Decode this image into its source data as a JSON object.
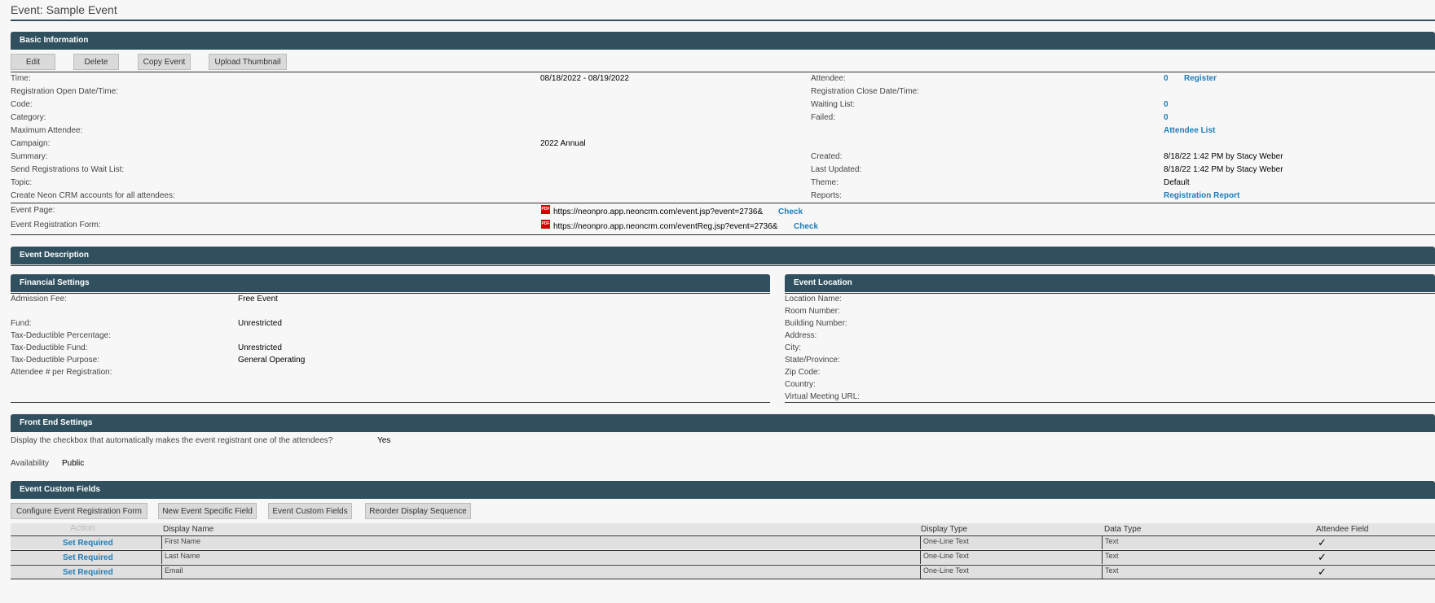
{
  "page": {
    "title": "Event: Sample Event"
  },
  "basic": {
    "header": "Basic Information",
    "buttons": {
      "edit": "Edit",
      "delete": "Delete",
      "copy": "Copy Event",
      "upload": "Upload Thumbnail"
    },
    "labels": {
      "time": "Time:",
      "reg_open": "Registration Open Date/Time:",
      "code": "Code:",
      "category": "Category:",
      "max_attendee": "Maximum Attendee:",
      "campaign": "Campaign:",
      "summary": "Summary:",
      "send_wait": "Send Registrations to Wait List:",
      "topic": "Topic:",
      "create_accounts": "Create Neon CRM accounts for all attendees:",
      "attendee": "Attendee:",
      "reg_close": "Registration Close Date/Time:",
      "waiting": "Waiting List:",
      "failed": "Failed:",
      "created": "Created:",
      "last_updated": "Last Updated:",
      "theme": "Theme:",
      "reports": "Reports:",
      "event_page": "Event Page:",
      "event_reg_form": "Event Registration Form:"
    },
    "values": {
      "time": "08/18/2022 - 08/19/2022",
      "campaign": "2022 Annual",
      "attendee_count": "0",
      "register": "Register",
      "waiting_count": "0",
      "failed_count": "0",
      "attendee_list": "Attendee List",
      "created": "8/18/22 1:42 PM by Stacy Weber",
      "last_updated": "8/18/22 1:42 PM by Stacy Weber",
      "theme": "Default",
      "reports": "Registration Report",
      "event_page_url": "https://neonpro.app.neoncrm.com/event.jsp?event=2736&",
      "event_reg_url": "https://neonpro.app.neoncrm.com/eventReg.jsp?event=2736&",
      "check": "Check",
      "pdf_icon_text": "PDF"
    }
  },
  "description": {
    "header": "Event Description"
  },
  "financial": {
    "header": "Financial Settings",
    "labels": {
      "fee": "Admission Fee:",
      "fund": "Fund:",
      "tax_pct": "Tax-Deductible Percentage:",
      "tax_fund": "Tax-Deductible Fund:",
      "tax_purpose": "Tax-Deductible Purpose:",
      "per_reg": "Attendee # per Registration:"
    },
    "values": {
      "fee": "Free Event",
      "fund": "Unrestricted",
      "tax_fund": "Unrestricted",
      "tax_purpose": "General Operating"
    }
  },
  "location": {
    "header": "Event Location",
    "labels": {
      "name": "Location Name:",
      "room": "Room Number:",
      "building": "Building Number:",
      "address": "Address:",
      "city": "City:",
      "state": "State/Province:",
      "zip": "Zip Code:",
      "country": "Country:",
      "virtual": "Virtual Meeting URL:"
    }
  },
  "frontend": {
    "header": "Front End Settings",
    "checkbox_q": "Display the checkbox that automatically makes the event registrant one of the attendees?",
    "checkbox_a": "Yes",
    "availability_label": "Availability",
    "availability_value": "Public"
  },
  "custom": {
    "header": "Event Custom Fields",
    "buttons": {
      "configure": "Configure Event Registration Form",
      "new_field": "New Event Specific Field",
      "custom_fields": "Event Custom Fields",
      "reorder": "Reorder Display Sequence"
    },
    "columns": {
      "action": "Action",
      "display_name": "Display Name",
      "display_type": "Display Type",
      "data_type": "Data Type",
      "attendee_field": "Attendee Field"
    },
    "rows": [
      {
        "action": "Set Required",
        "name": "First Name",
        "display_type": "One-Line Text",
        "data_type": "Text",
        "attendee": "✓"
      },
      {
        "action": "Set Required",
        "name": "Last Name",
        "display_type": "One-Line Text",
        "data_type": "Text",
        "attendee": "✓"
      },
      {
        "action": "Set Required",
        "name": "Email",
        "display_type": "One-Line Text",
        "data_type": "Text",
        "attendee": "✓"
      }
    ]
  },
  "colors": {
    "header_bar": "#30505f",
    "link": "#1f7db8",
    "background": "#f7f7f7"
  }
}
